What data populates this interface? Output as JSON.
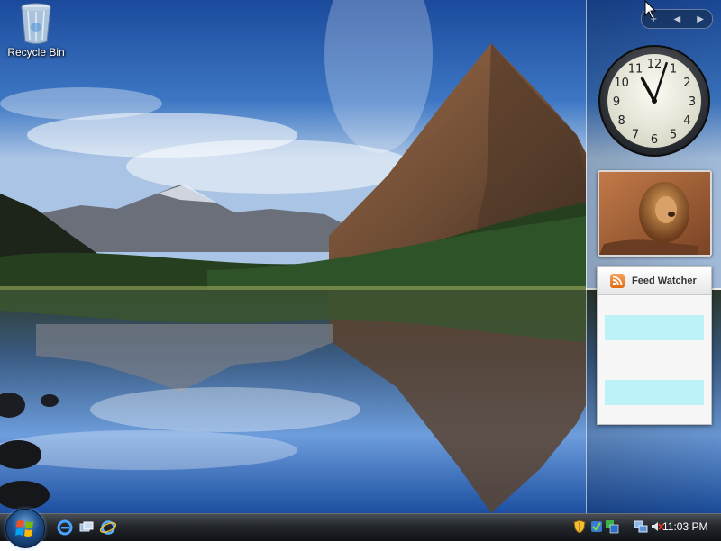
{
  "desktop": {
    "icons": [
      {
        "label": "Recycle Bin",
        "icon": "recycle-bin-icon"
      }
    ]
  },
  "sidebar": {
    "clock": {
      "hour": 11,
      "minute": 3
    },
    "slideshow": {
      "subject": "lion-photo"
    },
    "feed_watcher": {
      "title": "Feed Watcher",
      "icon": "rss-icon"
    }
  },
  "taskbar": {
    "start_icon": "windows-logo-icon",
    "quick_launch": [
      "ie-icon",
      "switch-windows-icon",
      "ie-icon"
    ],
    "tray_icons": [
      "shield-icon",
      "windows-defender-icon",
      "network-icon",
      "monitor-network-icon",
      "volume-muted-icon"
    ],
    "time": "11:03 PM"
  },
  "colors": {
    "feed_item_bg": "#bdf2f9",
    "taskbar_dark": "#101215",
    "sky_blue": "#2a5fae"
  }
}
